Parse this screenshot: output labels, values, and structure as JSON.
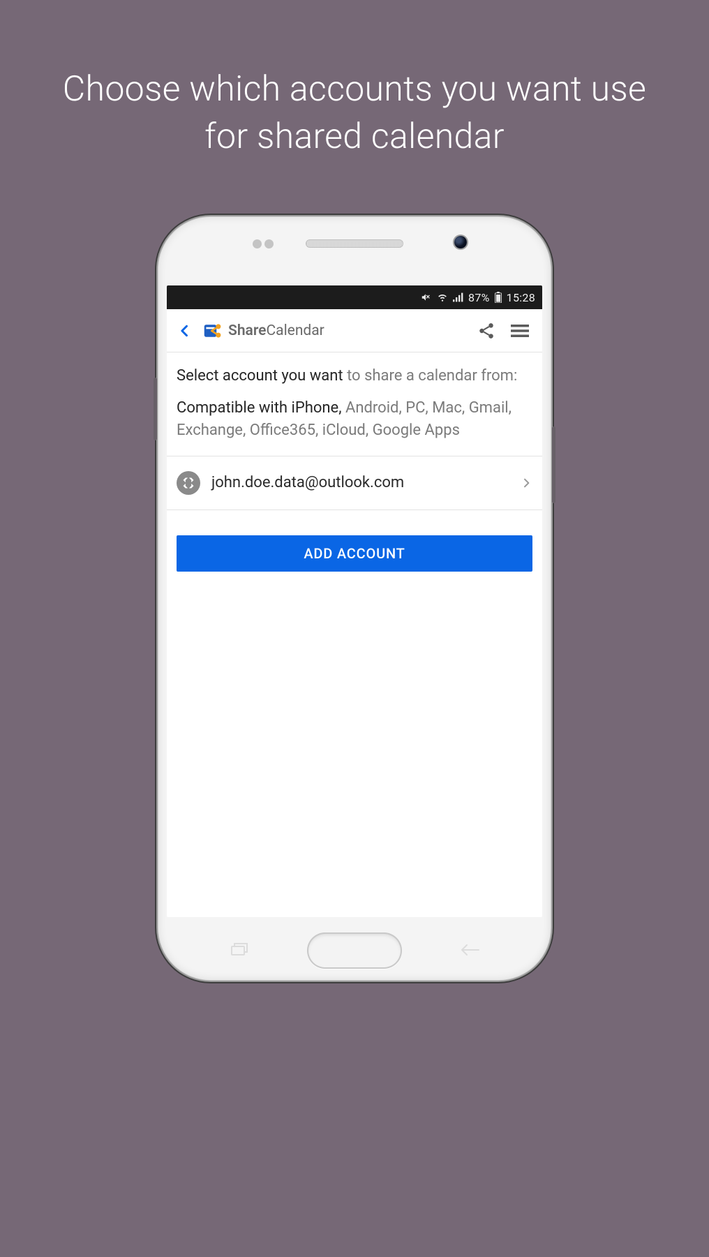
{
  "headline": "Choose which accounts you want use for shared calendar",
  "status": {
    "battery_pct": "87%",
    "time": "15:28"
  },
  "appbar": {
    "brand_share": "Share",
    "brand_calendar": "Calendar"
  },
  "content": {
    "p1_a": "Select account you want ",
    "p1_b": "to share a calendar from:",
    "p2_a": "Compatible with iPhone, ",
    "p2_b": "Android, PC, Mac, Gmail, Exchange, Office365, iCloud, Google Apps"
  },
  "account": {
    "email": "john.doe.data@outlook.com"
  },
  "buttons": {
    "add_account": "ADD ACCOUNT"
  }
}
